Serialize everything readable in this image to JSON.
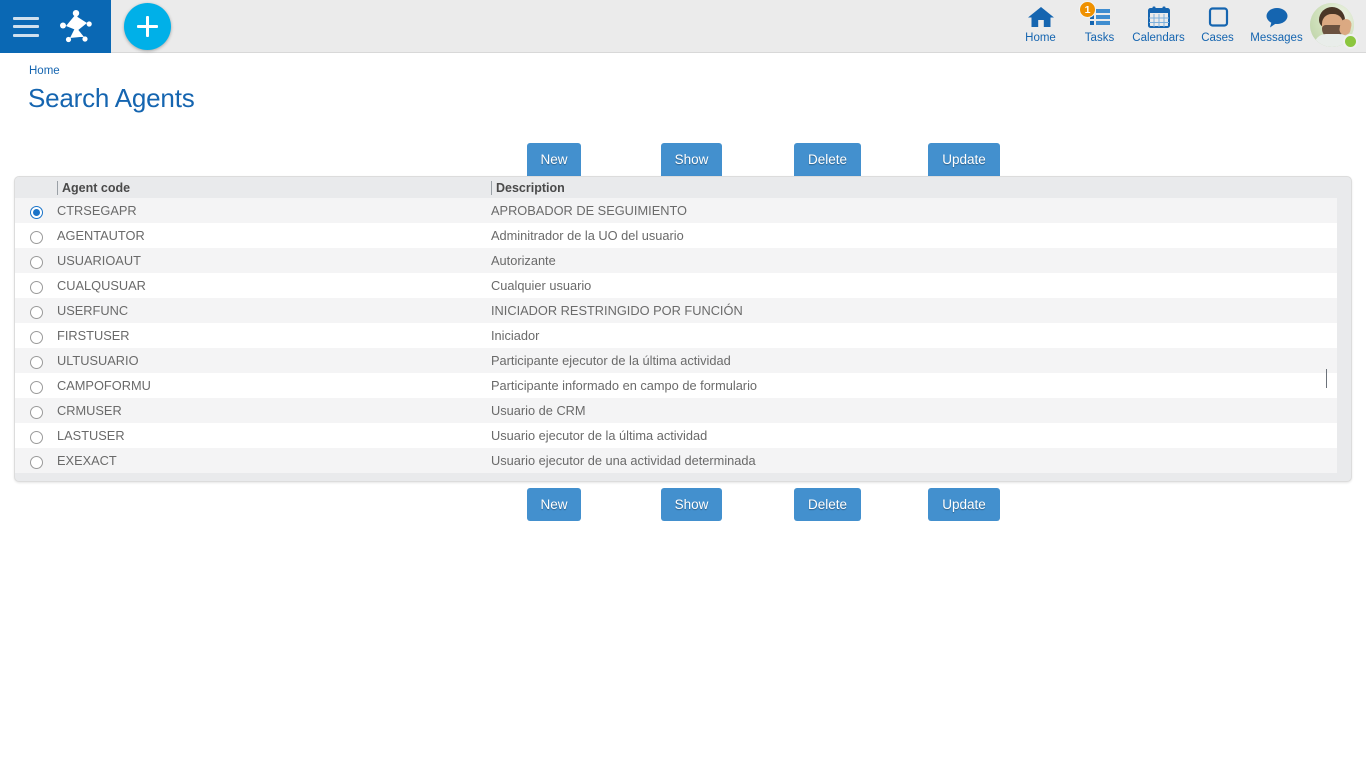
{
  "topbar": {
    "menu_icon": "hamburger-menu-icon",
    "logo_icon": "app-logo-icon",
    "add_button_label": "+",
    "nav": [
      {
        "label": "Home",
        "icon": "home-icon",
        "badge": null
      },
      {
        "label": "Tasks",
        "icon": "tasks-icon",
        "badge": "1"
      },
      {
        "label": "Calendars",
        "icon": "calendar-icon",
        "badge": null
      },
      {
        "label": "Cases",
        "icon": "cases-icon",
        "badge": null
      },
      {
        "label": "Messages",
        "icon": "messages-icon",
        "badge": null
      }
    ],
    "avatar": {
      "icon": "user-avatar",
      "status": "online"
    }
  },
  "breadcrumb": {
    "home_label": "Home"
  },
  "page": {
    "title": "Search Agents"
  },
  "toolbar": {
    "buttons": [
      {
        "label": "New"
      },
      {
        "label": "Show"
      },
      {
        "label": "Delete"
      },
      {
        "label": "Update"
      }
    ]
  },
  "table": {
    "columns": [
      {
        "key": "code",
        "label": "Agent code"
      },
      {
        "key": "desc",
        "label": "Description"
      }
    ],
    "selected_index": 0,
    "rows": [
      {
        "code": "CTRSEGAPR",
        "desc": "APROBADOR DE SEGUIMIENTO"
      },
      {
        "code": "AGENTAUTOR",
        "desc": "Adminitrador de la UO del usuario"
      },
      {
        "code": "USUARIOAUT",
        "desc": "Autorizante"
      },
      {
        "code": "CUALQUSUAR",
        "desc": "Cualquier usuario"
      },
      {
        "code": "USERFUNC",
        "desc": "INICIADOR RESTRINGIDO POR FUNCIÓN"
      },
      {
        "code": "FIRSTUSER",
        "desc": "Iniciador"
      },
      {
        "code": "ULTUSUARIO",
        "desc": "Participante ejecutor de la última actividad"
      },
      {
        "code": "CAMPOFORMU",
        "desc": "Participante informado en campo de formulario"
      },
      {
        "code": "CRMUSER",
        "desc": "Usuario de CRM"
      },
      {
        "code": "LASTUSER",
        "desc": "Usuario ejecutor de la última actividad"
      },
      {
        "code": "EXEXACT",
        "desc": "Usuario ejecutor de una actividad determinada"
      }
    ]
  },
  "colors": {
    "brand_blue": "#0a68b4",
    "accent_cyan": "#00b0e8",
    "button_blue": "#4390ce",
    "link_blue": "#1565b0",
    "badge_orange": "#ef9100",
    "status_green": "#8cc63e"
  }
}
